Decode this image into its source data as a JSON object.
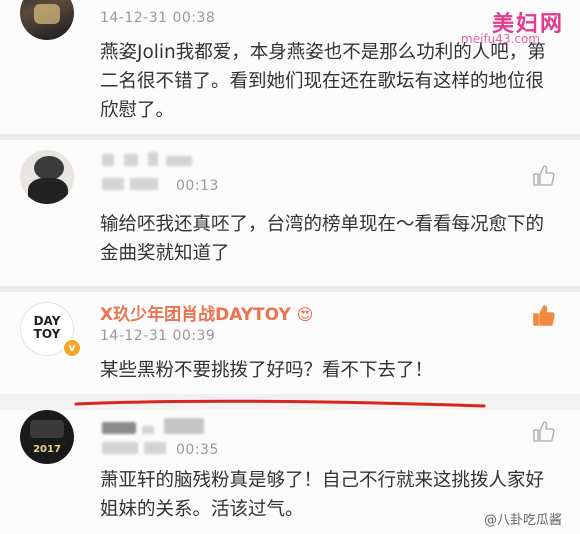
{
  "watermark": {
    "brand": "美妇网",
    "url": "meifu43.com",
    "source": "@八卦吃瓜酱"
  },
  "comments": [
    {
      "time": "14-12-31 00:38",
      "text": "燕姿Jolin我都爱，本身燕姿也不是那么功利的人吧，第二名很不错了。看到她们现在还在歌坛有这样的地位很欣慰了。"
    },
    {
      "time": "00:13",
      "text": "输给呸我还真呸了，台湾的榜单现在～看看每况愈下的金曲奖就知道了"
    },
    {
      "name": "X玖少年团肖战DAYTOY",
      "name_emoji": "😍",
      "avatar_text": "DAY TOY",
      "verified_badge": "v",
      "time": "14-12-31 00:39",
      "text": "某些黑粉不要挑拨了好吗？看不下去了！"
    },
    {
      "avatar_text": "2017",
      "time": "00:35",
      "text": "萧亚轩的脑残粉真是够了！自己不行就来这挑拨人家好姐妹的关系。活该过气。"
    }
  ],
  "colors": {
    "username": "#eb7350",
    "underline": "#d9261c",
    "like_active": "#f08a3c",
    "like_idle": "#b5b5b5",
    "watermark": "#e33a8c"
  },
  "icons": [
    "thumbs-up-icon",
    "verified-icon",
    "face-emoji-icon"
  ]
}
